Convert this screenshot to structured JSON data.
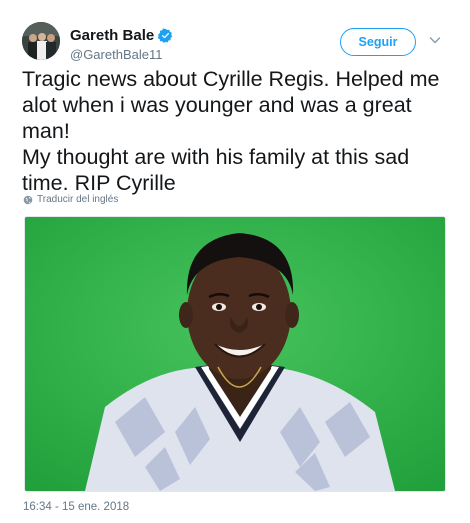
{
  "author": {
    "display_name": "Gareth Bale",
    "handle": "@GarethBale11",
    "verified": true
  },
  "follow_label": "Seguir",
  "tweet": {
    "paragraph_1": "Tragic news about Cyrille Regis. Helped me alot when i was younger and was a great man!",
    "paragraph_2": "My thought are with his family at this sad time. RIP Cyrille"
  },
  "translate_label": "Traducir del inglés",
  "timestamp": "16:34 - 15 ene. 2018",
  "colors": {
    "accent": "#1da1f2",
    "text": "#14171a",
    "secondary_text": "#657786",
    "photo_background": "#2fb349"
  },
  "icons": {
    "verified": "verified-badge-icon",
    "menu": "chevron-down-icon",
    "translate": "globe-icon"
  }
}
